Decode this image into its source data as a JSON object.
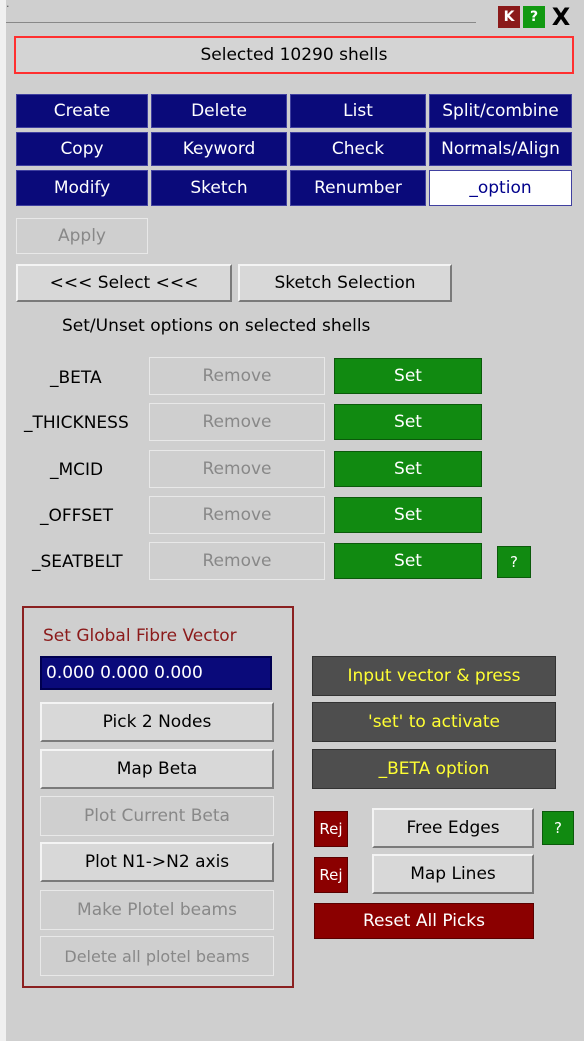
{
  "header": {
    "title_bar_dot": "·",
    "k_label": "K",
    "help_label": "?",
    "close_label": "X"
  },
  "status": {
    "text": "Selected 10290 shells"
  },
  "grid": [
    [
      "Create",
      "Delete",
      "List",
      "Split/combine"
    ],
    [
      "Copy",
      "Keyword",
      "Check",
      "Normals/Align"
    ],
    [
      "Modify",
      "Sketch",
      "Renumber",
      "_option"
    ]
  ],
  "apply_label": "Apply",
  "select_label": "<<< Select <<<",
  "sketch_selection_label": "Sketch Selection",
  "options_heading": "Set/Unset options on selected shells",
  "options": [
    {
      "name": "_BETA",
      "remove": "Remove",
      "set": "Set"
    },
    {
      "name": "_THICKNESS",
      "remove": "Remove",
      "set": "Set"
    },
    {
      "name": "_MCID",
      "remove": "Remove",
      "set": "Set"
    },
    {
      "name": "_OFFSET",
      "remove": "Remove",
      "set": "Set"
    },
    {
      "name": "_SEATBELT",
      "remove": "Remove",
      "set": "Set"
    }
  ],
  "seatbelt_help": "?",
  "fibre": {
    "title": "Set Global Fibre Vector",
    "vector_value": "0.000 0.000 0.000",
    "buttons": [
      "Pick 2 Nodes",
      "Map Beta",
      "Plot Current Beta",
      "Plot N1->N2 axis",
      "Make Plotel beams",
      "Delete all plotel beams"
    ]
  },
  "info": [
    "Input vector & press",
    "'set' to activate",
    "_BETA option"
  ],
  "rej_label": "Rej",
  "free_edges_label": "Free Edges",
  "free_edges_help": "?",
  "map_lines_label": "Map Lines",
  "reset_label": "Reset All Picks",
  "colors": {
    "panel": "#cfcfcf",
    "blue": "#0a0a7a",
    "green": "#118a11",
    "darkred": "#8b0000",
    "info_text": "#ffff33"
  }
}
